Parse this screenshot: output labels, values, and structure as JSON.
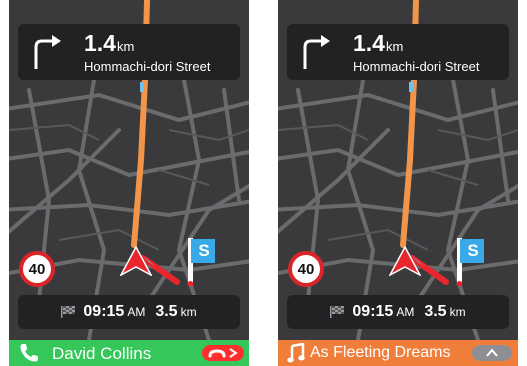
{
  "screens": [
    {
      "nav": {
        "distance_value": "1.4",
        "distance_unit": "km",
        "street": "Hommachi-dori Street",
        "maneuver_icon": "turn-right-arrow-icon"
      },
      "speed_limit": "40",
      "destination_flag_label": "S",
      "eta": {
        "time": "09:15",
        "ampm": "AM",
        "distance_value": "3.5",
        "distance_unit": "km"
      },
      "bottom_bar": {
        "kind": "call",
        "text": "David Collins",
        "left_icon": "phone-icon",
        "action_icon": "hang-up-icon",
        "color": "#35c759"
      }
    },
    {
      "nav": {
        "distance_value": "1.4",
        "distance_unit": "km",
        "street": "Hommachi-dori Street",
        "maneuver_icon": "turn-right-arrow-icon"
      },
      "speed_limit": "40",
      "destination_flag_label": "S",
      "eta": {
        "time": "09:15",
        "ampm": "AM",
        "distance_value": "3.5",
        "distance_unit": "km"
      },
      "bottom_bar": {
        "kind": "music",
        "text": "As Fleeting Dreams",
        "left_icon": "music-note-icon",
        "action_icon": "chevron-up-icon",
        "color": "#f07e3b"
      }
    }
  ],
  "colors": {
    "map_background": "#3a3a3c",
    "map_roads": "#6d6d70",
    "route": "#f2954a",
    "car_arrow": "#e8262b",
    "flag": "#3aa9e8",
    "speed_limit_ring": "#d9252a",
    "card_background": "#222224"
  }
}
